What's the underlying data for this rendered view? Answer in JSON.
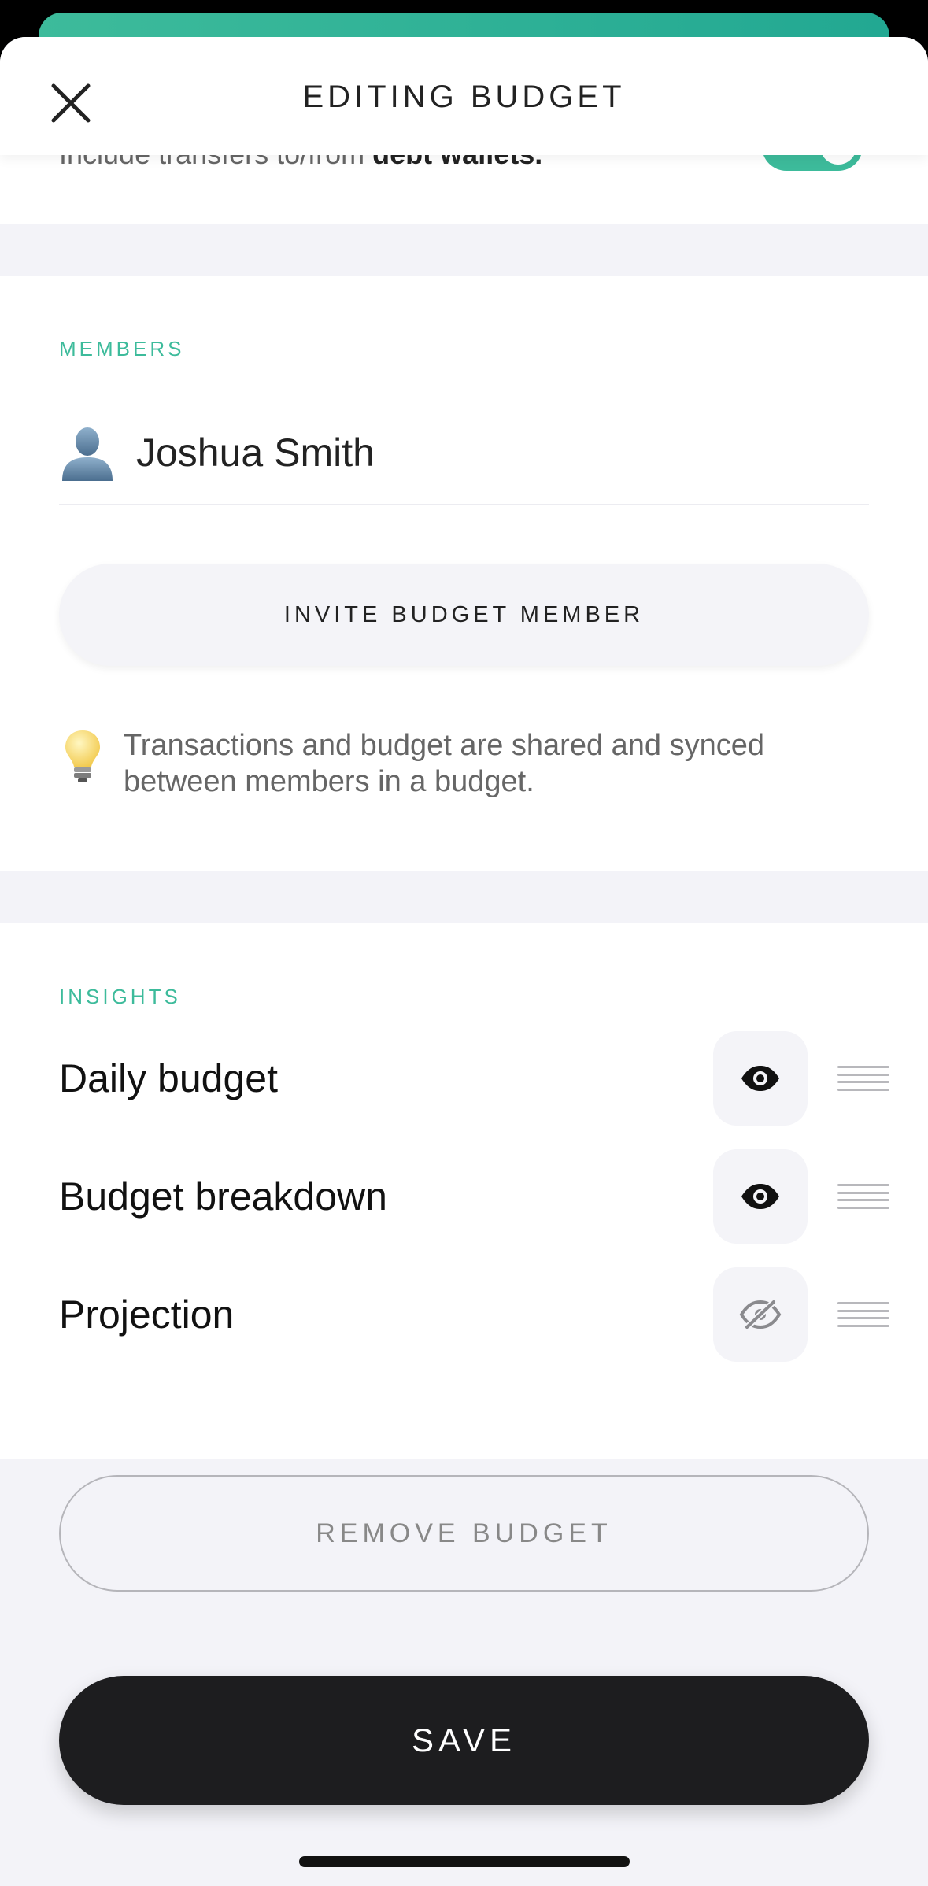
{
  "header": {
    "title": "EDITING BUDGET"
  },
  "top_setting": {
    "text_prefix": "Include transfers to/from ",
    "text_bold": "debt wallets."
  },
  "members": {
    "section_label": "MEMBERS",
    "items": [
      {
        "name": "Joshua Smith",
        "icon": "user-avatar-icon"
      }
    ],
    "invite_label": "INVITE BUDGET MEMBER",
    "tip_icon": "light-bulb-icon",
    "tip_text": "Transactions and budget are shared and synced between members in a budget."
  },
  "insights": {
    "section_label": "INSIGHTS",
    "items": [
      {
        "label": "Daily budget",
        "visible": true,
        "icon": "eye-icon"
      },
      {
        "label": "Budget breakdown",
        "visible": true,
        "icon": "eye-icon"
      },
      {
        "label": "Projection",
        "visible": false,
        "icon": "eye-off-icon"
      }
    ]
  },
  "actions": {
    "remove_label": "REMOVE BUDGET",
    "save_label": "SAVE"
  },
  "colors": {
    "accent": "#3dbb9b",
    "save_bg": "#1d1d1f",
    "background": "#f3f3f8"
  }
}
